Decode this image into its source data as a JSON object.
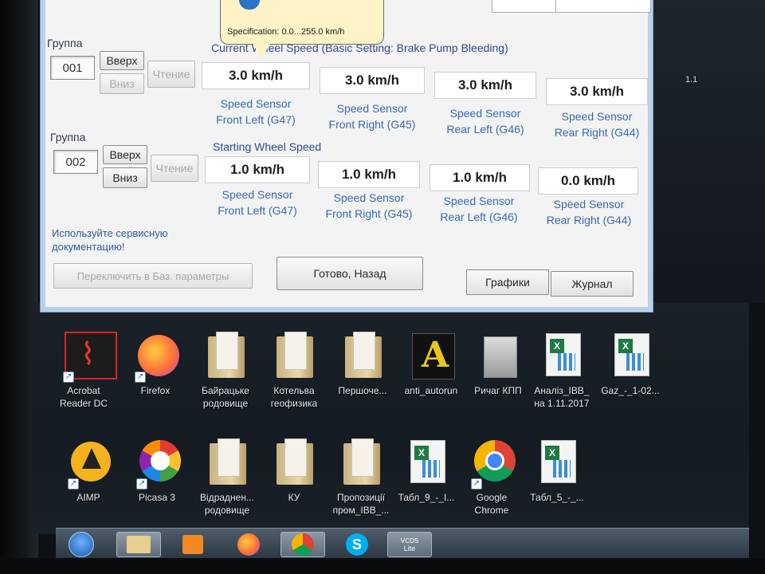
{
  "tooltip": {
    "text": "Specification: 0.0...255.0 km/h"
  },
  "group1": {
    "label": "Группа",
    "number": "001",
    "up": "Вверх",
    "down": "Вниз",
    "read": "Чтение",
    "title": "Current Wheel Speed (Basic Setting: Brake Pump Bleeding)",
    "values": [
      "3.0 km/h",
      "3.0 km/h",
      "3.0 km/h",
      "3.0 km/h"
    ],
    "labels": [
      [
        "Speed Sensor",
        "Front Left (G47)"
      ],
      [
        "Speed Sensor",
        "Front Right (G45)"
      ],
      [
        "Speed Sensor",
        "Rear Left (G46)"
      ],
      [
        "Speed Sensor",
        "Rear Right (G44)"
      ]
    ]
  },
  "group2": {
    "label": "Группа",
    "number": "002",
    "up": "Вверх",
    "down": "Вниз",
    "read": "Чтение",
    "title": "Starting Wheel Speed",
    "values": [
      "1.0 km/h",
      "1.0 km/h",
      "1.0 km/h",
      "0.0 km/h"
    ],
    "labels": [
      [
        "Speed Sensor",
        "Front Left (G47)"
      ],
      [
        "Speed Sensor",
        "Front Right (G45)"
      ],
      [
        "Speed Sensor",
        "Rear Left (G46)"
      ],
      [
        "Speed Sensor",
        "Rear Right (G44)"
      ]
    ]
  },
  "note": [
    "Используйте сервисную",
    "документацию!"
  ],
  "buttons": {
    "switch_basic": "Переключить в Баз. параметры",
    "done_back": "Готово, Назад",
    "graphs": "Графики",
    "log": "Журнал"
  },
  "side": {
    "right_number": "1.1"
  },
  "desktop": {
    "row1": [
      {
        "l1": "Acrobat",
        "l2": "Reader DC",
        "icon": "acrobat-icon"
      },
      {
        "l1": "Firefox",
        "l2": "",
        "icon": "firefox-icon"
      },
      {
        "l1": "Байрацьке",
        "l2": "родовище",
        "icon": "folder-icon"
      },
      {
        "l1": "Котельва",
        "l2": "геофизика",
        "icon": "folder-icon"
      },
      {
        "l1": "Першоче...",
        "l2": "",
        "icon": "folder-icon"
      },
      {
        "l1": "anti_autorun",
        "l2": "",
        "icon": "anti-autorun-icon"
      },
      {
        "l1": "Ричаг КПП",
        "l2": "",
        "icon": "image-file-icon"
      },
      {
        "l1": "Аналіз_IBB_",
        "l2": "на 1.11.2017",
        "icon": "excel-icon"
      },
      {
        "l1": "Gaz_-_1-02...",
        "l2": "",
        "icon": "excel-icon"
      }
    ],
    "row2": [
      {
        "l1": "AIMP",
        "l2": "",
        "icon": "aimp-icon"
      },
      {
        "l1": "Picasa 3",
        "l2": "",
        "icon": "picasa-icon"
      },
      {
        "l1": "Відраднен...",
        "l2": "родовище",
        "icon": "folder-icon"
      },
      {
        "l1": "КУ",
        "l2": "",
        "icon": "folder-icon"
      },
      {
        "l1": "Пропозиції",
        "l2": "пром_IBB_...",
        "icon": "folder-icon"
      },
      {
        "l1": "Табл_9_-_І...",
        "l2": "",
        "icon": "excel-icon"
      },
      {
        "l1": "Google",
        "l2": "Chrome",
        "icon": "chrome-icon"
      },
      {
        "l1": "Табл_5_-_...",
        "l2": "",
        "icon": "excel-icon"
      }
    ]
  },
  "taskbar": {
    "vcds_label": "VCDS",
    "vcds_sub": "Lite"
  },
  "colors": {
    "window_border": "#b9d0e6",
    "sensor_label": "#3769b3",
    "section_title": "#2c4c8c",
    "desktop": "#151b22"
  }
}
